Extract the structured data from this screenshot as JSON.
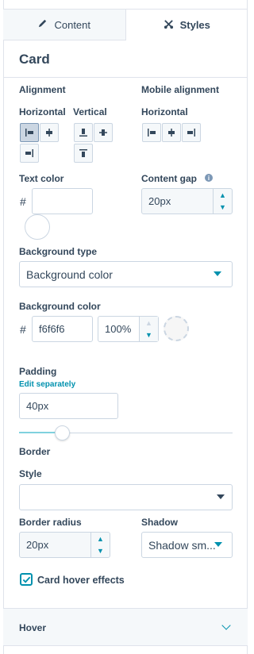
{
  "tabs": [
    {
      "label": "Content",
      "icon": "pencil-icon",
      "active": false
    },
    {
      "label": "Styles",
      "icon": "scissors-icon",
      "active": true
    }
  ],
  "section_title": "Card",
  "alignment": {
    "label": "Alignment",
    "horizontal_label": "Horizontal",
    "vertical_label": "Vertical",
    "mobile_label": "Mobile alignment",
    "mobile_horizontal_label": "Horizontal"
  },
  "text_color": {
    "label": "Text color",
    "hash": "#",
    "value": ""
  },
  "content_gap": {
    "label": "Content gap",
    "value": "20px"
  },
  "background_type": {
    "label": "Background type",
    "value": "Background color"
  },
  "background_color": {
    "label": "Background color",
    "hash": "#",
    "hex": "f6f6f6",
    "opacity": "100%",
    "swatch": "#f6f6f6"
  },
  "padding": {
    "label": "Padding",
    "edit_link": "Edit separately",
    "value": "40px",
    "slider_fraction": 0.2
  },
  "border": {
    "label": "Border",
    "style_label": "Style",
    "style_value": "",
    "radius_label": "Border radius",
    "radius_value": "20px"
  },
  "shadow": {
    "label": "Shadow",
    "value": "Shadow sm..."
  },
  "hover_effects": {
    "label": "Card hover effects",
    "checked": true
  },
  "hover_section": {
    "label": "Hover"
  },
  "colors": {
    "accent": "#0091ae",
    "text": "#33475b",
    "border": "#cbd6e2"
  }
}
